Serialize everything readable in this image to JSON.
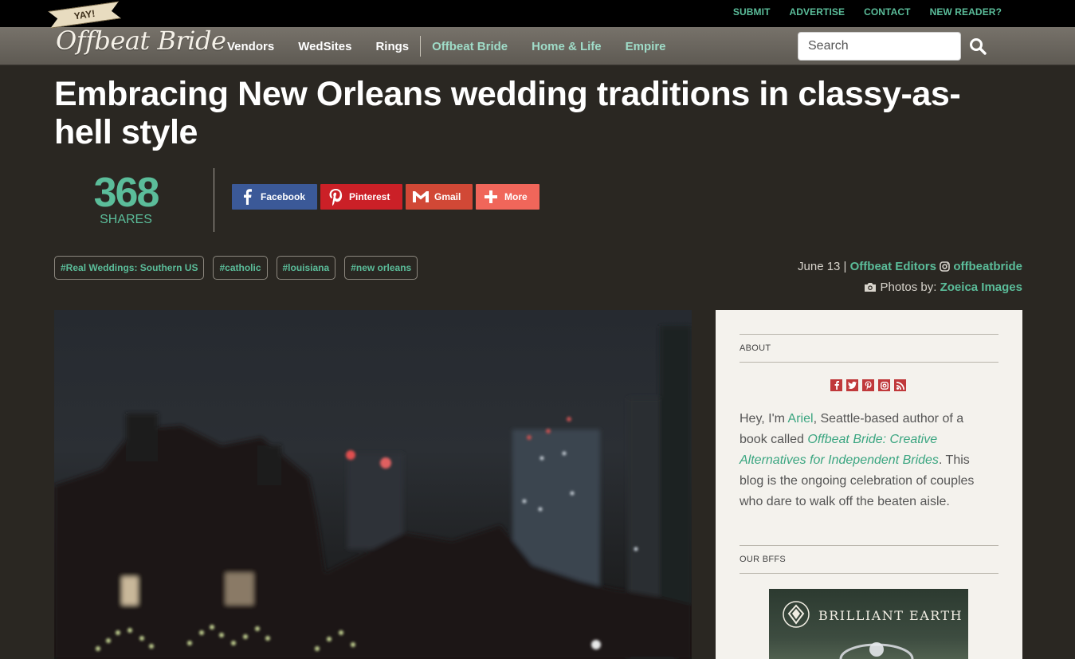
{
  "topbar": {
    "links": [
      "SUBMIT",
      "ADVERTISE",
      "CONTACT",
      "NEW READER?"
    ]
  },
  "logo": {
    "banner": "YAY!",
    "name": "Offbeat Bride"
  },
  "nav": {
    "items": [
      "Vendors",
      "WedSites",
      "Rings"
    ],
    "network_items": [
      "Offbeat Bride",
      "Home & Life",
      "Empire"
    ]
  },
  "search": {
    "placeholder": "Search"
  },
  "article": {
    "title": "Embracing New Orleans wedding traditions in classy-as-hell style",
    "shares": {
      "count": "368",
      "label": "SHARES"
    },
    "share_buttons": [
      "Facebook",
      "Pinterest",
      "Gmail",
      "More"
    ],
    "tags": [
      "#Real Weddings: Southern US",
      "#catholic",
      "#louisiana",
      "#new orleans"
    ],
    "meta": {
      "date": "June 13 |",
      "author": "Offbeat Editors",
      "instagram": "offbeatbride",
      "photos_label": "Photos by:",
      "photographer": "Zoeica Images"
    }
  },
  "sidebar": {
    "about_heading": "ABOUT",
    "about": {
      "t1": "Hey, I'm ",
      "name": "Ariel",
      "t2": ", Seattle-based author of a book called ",
      "book": "Offbeat Bride: Creative Alternatives for Independent Brides",
      "t3": ". This blog is the ongoing celebration of couples who dare to walk off the beaten aisle."
    },
    "bffs_heading": "OUR BFFS",
    "ad_name": "BRILLIANT EARTH"
  },
  "colors": {
    "accent": "#5bbd9a",
    "background": "#2a2722",
    "facebook": "#3b5998",
    "pinterest": "#cb2027",
    "gmail": "#d14836",
    "more": "#f0665a"
  },
  "icons": [
    "search-icon",
    "facebook-icon",
    "pinterest-icon",
    "gmail-icon",
    "plus-icon",
    "instagram-icon",
    "camera-icon",
    "twitter-icon",
    "rss-icon",
    "diamond-logo-icon"
  ]
}
